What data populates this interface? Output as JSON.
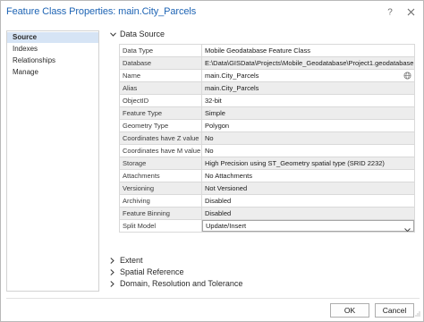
{
  "window": {
    "title": "Feature Class Properties: main.City_Parcels"
  },
  "nav": {
    "items": [
      {
        "label": "Source",
        "active": true
      },
      {
        "label": "Indexes",
        "active": false
      },
      {
        "label": "Relationships",
        "active": false
      },
      {
        "label": "Manage",
        "active": false
      }
    ]
  },
  "data_source": {
    "header": "Data Source",
    "rows": [
      {
        "key": "Data Type",
        "value": "Mobile Geodatabase Feature Class"
      },
      {
        "key": "Database",
        "value": "E:\\Data\\GISData\\Projects\\Mobile_Geodatabase\\Project1.geodatabase"
      },
      {
        "key": "Name",
        "value": "main.City_Parcels"
      },
      {
        "key": "Alias",
        "value": "main.City_Parcels"
      },
      {
        "key": "ObjectID",
        "value": "32-bit"
      },
      {
        "key": "Feature Type",
        "value": "Simple"
      },
      {
        "key": "Geometry Type",
        "value": "Polygon"
      },
      {
        "key": "Coordinates have Z value",
        "value": "No"
      },
      {
        "key": "Coordinates have M value",
        "value": "No"
      },
      {
        "key": "Storage",
        "value": "High Precision using ST_Geometry spatial type (SRID 2232)"
      },
      {
        "key": "Attachments",
        "value": "No Attachments"
      },
      {
        "key": "Versioning",
        "value": "Not Versioned"
      },
      {
        "key": "Archiving",
        "value": "Disabled"
      },
      {
        "key": "Feature Binning",
        "value": "Disabled"
      },
      {
        "key": "Split Model",
        "value": "Update/Insert"
      }
    ]
  },
  "collapsed_sections": [
    "Extent",
    "Spatial Reference",
    "Domain, Resolution and Tolerance"
  ],
  "buttons": {
    "ok": "OK",
    "cancel": "Cancel"
  },
  "icons": {
    "section_expanded": "chevron-down-icon",
    "section_collapsed": "chevron-right-icon",
    "name_field": "globe-icon",
    "split_model": "dropdown-arrow-icon",
    "window_help": "help-icon",
    "window_close": "close-icon"
  },
  "colors": {
    "title": "#1e64b4",
    "nav_active_bg": "#d6e4f5",
    "alt_row_bg": "#ededed"
  }
}
